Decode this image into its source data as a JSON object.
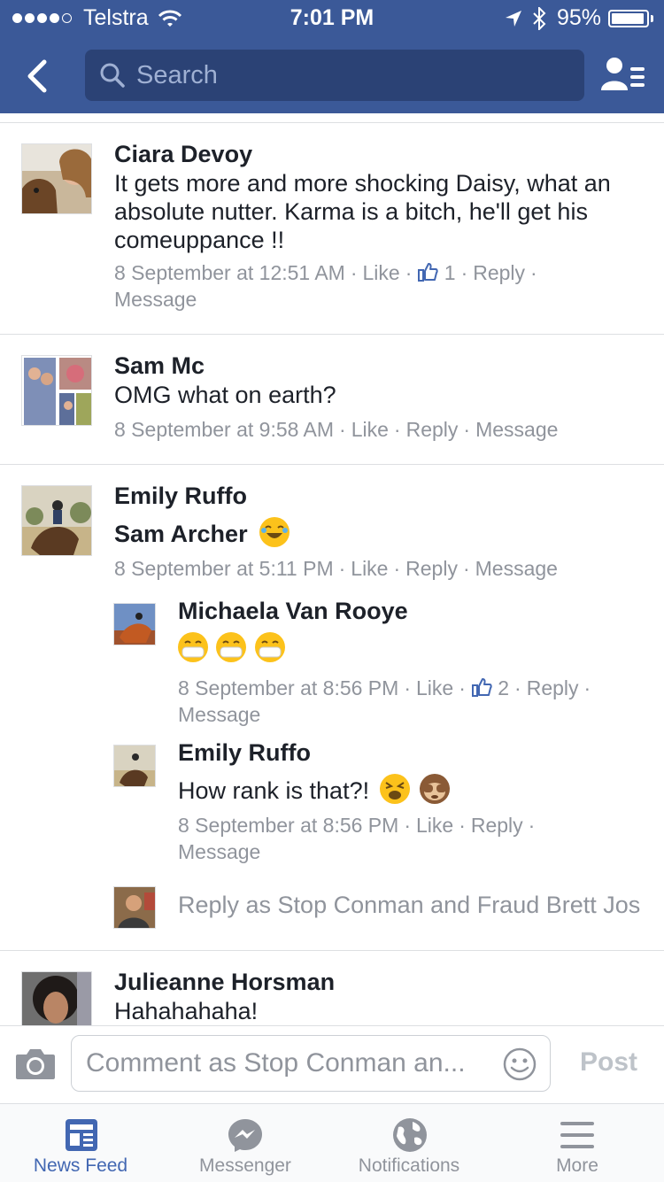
{
  "status_bar": {
    "carrier": "Telstra",
    "time": "7:01 PM",
    "battery": "95%",
    "battery_level": 0.95
  },
  "header": {
    "search_placeholder": "Search",
    "back_icon": "chevron-left-icon",
    "friends_icon": "friends-list-icon"
  },
  "colors": {
    "brand": "#3b5998",
    "link": "#4267b2",
    "meta": "#90949c"
  },
  "comments": [
    {
      "name": "Ciara Devoy",
      "text": "It gets more and more shocking Daisy, what an absolute nutter. Karma is a bitch, he'll get his comeuppance !!",
      "time": "8 September at 12:51 AM",
      "like": "Like",
      "likes": "1",
      "reply": "Reply",
      "message": "Message"
    },
    {
      "name": "Sam Mc",
      "text": "OMG what on earth?",
      "time": "8 September at 9:58 AM",
      "like": "Like",
      "reply": "Reply",
      "message": "Message"
    },
    {
      "name": "Emily Ruffo",
      "text": "Sam Archer",
      "time": "8 September at 5:11 PM",
      "like": "Like",
      "reply": "Reply",
      "message": "Message",
      "replies": [
        {
          "name": "Michaela Van Rooye",
          "time": "8 September at 8:56 PM",
          "like": "Like",
          "likes": "2",
          "reply": "Reply",
          "message": "Message"
        },
        {
          "name": "Emily Ruffo",
          "text": "How rank is that?!",
          "time": "8 September at 8:56 PM",
          "like": "Like",
          "reply": "Reply",
          "message": "Message"
        }
      ],
      "reply_as": "Reply as Stop Conman and Fraud Brett Jos"
    },
    {
      "name": "Julieanne Horsman",
      "text": "Hahahahaha!"
    }
  ],
  "composer": {
    "placeholder": "Comment as Stop Conman an...",
    "post": "Post"
  },
  "tabs": [
    {
      "label": "News Feed",
      "icon": "news-feed-icon",
      "active": true
    },
    {
      "label": "Messenger",
      "icon": "messenger-icon",
      "active": false
    },
    {
      "label": "Notifications",
      "icon": "globe-icon",
      "active": false
    },
    {
      "label": "More",
      "icon": "menu-icon",
      "active": false
    }
  ]
}
